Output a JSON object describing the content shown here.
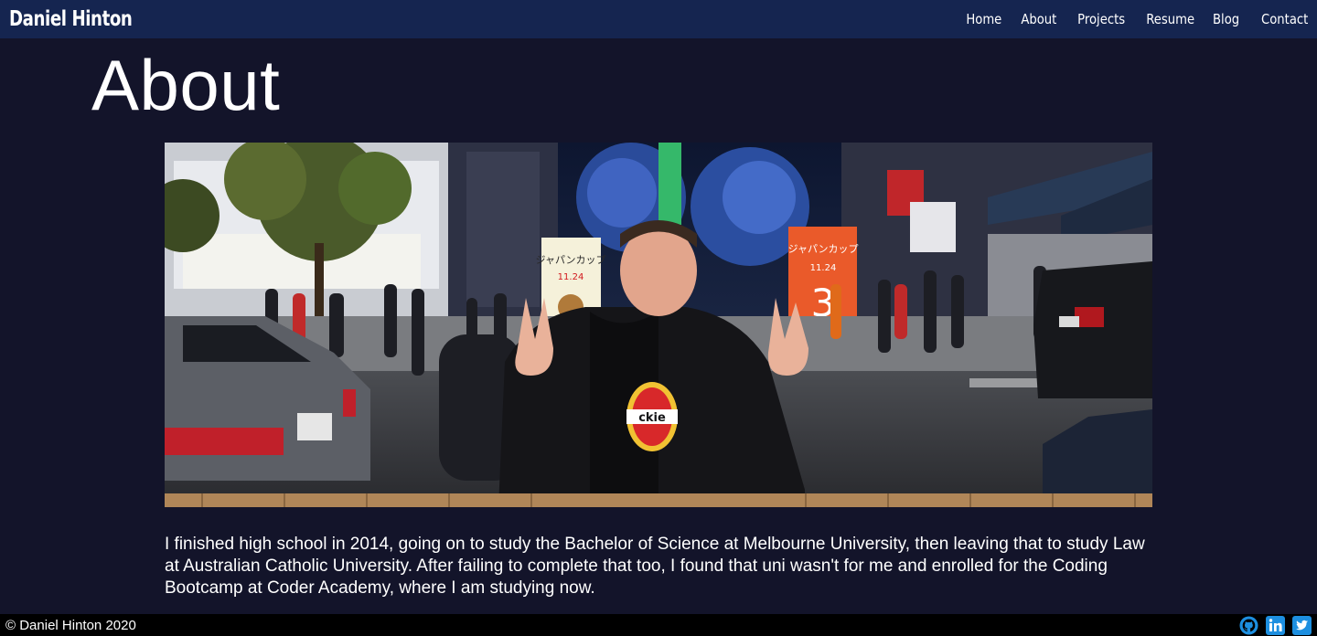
{
  "navbar": {
    "brand": "Daniel Hinton",
    "links": [
      {
        "label": "Home"
      },
      {
        "label": "About"
      },
      {
        "label": "Projects"
      },
      {
        "label": "Resume"
      },
      {
        "label": "Blog"
      },
      {
        "label": "Contact"
      }
    ]
  },
  "main": {
    "title": "About",
    "photo": {
      "signs": {
        "japan_cup": "ジャパンカップ",
        "date": "11.24",
        "number": "3",
        "shirt": "ckie"
      }
    },
    "paragraph": "I finished high school in 2014, going on to study the Bachelor of Science at Melbourne University, then leaving that to study Law at Australian Catholic University. After failing to complete that too, I found that uni wasn't for me and enrolled for the Coding Bootcamp at Coder Academy, where I am studying now."
  },
  "footer": {
    "copyright": "© Daniel Hinton 2020",
    "social_icons": [
      "github-icon",
      "linkedin-icon",
      "twitter-icon"
    ]
  },
  "colors": {
    "navbar": "#152550",
    "background": "#13142a",
    "footer": "#000000",
    "accent_blue": "#1d8fe0"
  }
}
